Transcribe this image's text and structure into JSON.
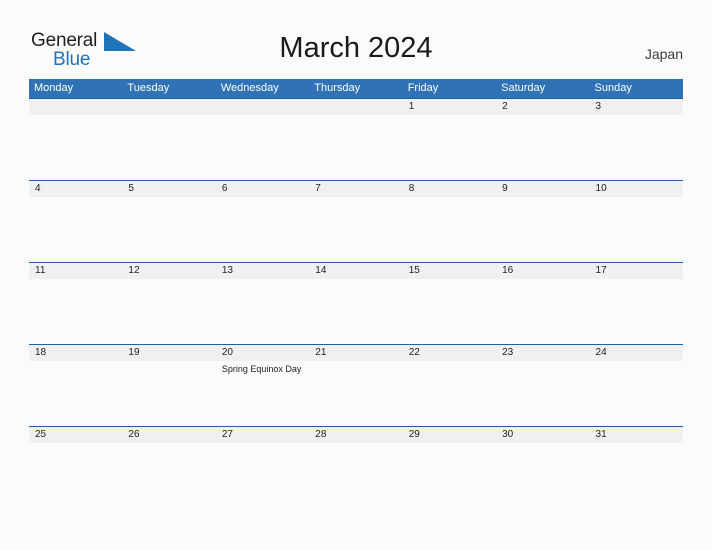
{
  "brand": {
    "name_line1": "General",
    "name_line2": "Blue",
    "triangle_icon": "triangle-logo-icon",
    "color_dark": "#231f20",
    "color_blue": "#1f73b8"
  },
  "header": {
    "title": "March 2024",
    "country": "Japan"
  },
  "colors": {
    "header_blue": "#2f72b5",
    "separator_blue": "#2061a3",
    "daynum_band": "#f0f0f0",
    "page_background": "#fbfbfc"
  },
  "calendar": {
    "weekdays": [
      "Monday",
      "Tuesday",
      "Wednesday",
      "Thursday",
      "Friday",
      "Saturday",
      "Sunday"
    ],
    "weeks": [
      {
        "days": [
          {
            "num": "",
            "event": ""
          },
          {
            "num": "",
            "event": ""
          },
          {
            "num": "",
            "event": ""
          },
          {
            "num": "",
            "event": ""
          },
          {
            "num": "1",
            "event": ""
          },
          {
            "num": "2",
            "event": ""
          },
          {
            "num": "3",
            "event": ""
          }
        ]
      },
      {
        "days": [
          {
            "num": "4",
            "event": ""
          },
          {
            "num": "5",
            "event": ""
          },
          {
            "num": "6",
            "event": ""
          },
          {
            "num": "7",
            "event": ""
          },
          {
            "num": "8",
            "event": ""
          },
          {
            "num": "9",
            "event": ""
          },
          {
            "num": "10",
            "event": ""
          }
        ]
      },
      {
        "days": [
          {
            "num": "11",
            "event": ""
          },
          {
            "num": "12",
            "event": ""
          },
          {
            "num": "13",
            "event": ""
          },
          {
            "num": "14",
            "event": ""
          },
          {
            "num": "15",
            "event": ""
          },
          {
            "num": "16",
            "event": ""
          },
          {
            "num": "17",
            "event": ""
          }
        ]
      },
      {
        "days": [
          {
            "num": "18",
            "event": ""
          },
          {
            "num": "19",
            "event": ""
          },
          {
            "num": "20",
            "event": "Spring Equinox Day"
          },
          {
            "num": "21",
            "event": ""
          },
          {
            "num": "22",
            "event": ""
          },
          {
            "num": "23",
            "event": ""
          },
          {
            "num": "24",
            "event": ""
          }
        ]
      },
      {
        "days": [
          {
            "num": "25",
            "event": ""
          },
          {
            "num": "26",
            "event": ""
          },
          {
            "num": "27",
            "event": ""
          },
          {
            "num": "28",
            "event": ""
          },
          {
            "num": "29",
            "event": ""
          },
          {
            "num": "30",
            "event": ""
          },
          {
            "num": "31",
            "event": ""
          }
        ]
      }
    ]
  }
}
